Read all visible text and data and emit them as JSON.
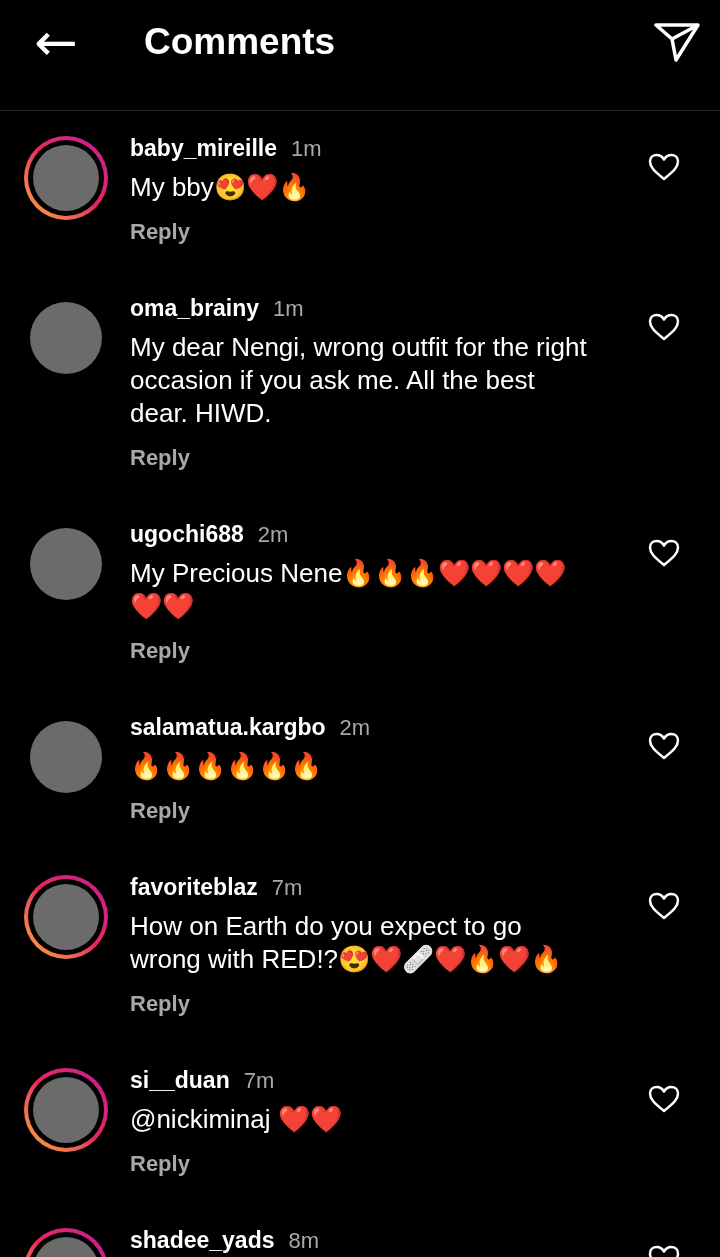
{
  "header": {
    "back_icon": "←",
    "title": "Comments"
  },
  "comments": [
    {
      "username": "baby_mireille",
      "time": "1m",
      "text": "My bby😍❤️🔥",
      "reply": "Reply",
      "story_ring": true
    },
    {
      "username": "oma_brainy",
      "time": "1m",
      "text": "My dear Nengi, wrong outfit for the right occasion if you ask me. All the best dear. HIWD.",
      "reply": "Reply",
      "story_ring": false
    },
    {
      "username": "ugochi688",
      "time": "2m",
      "text": "My Precious Nene🔥🔥🔥❤️❤️❤️❤️❤️❤️",
      "reply": "Reply",
      "story_ring": false
    },
    {
      "username": "salamatua.kargbo",
      "time": "2m",
      "text": "🔥🔥🔥🔥🔥🔥",
      "reply": "Reply",
      "story_ring": false
    },
    {
      "username": "favoriteblaz",
      "time": "7m",
      "text": "How on Earth do you expect to go wrong with RED!?😍❤️🩹❤️🔥❤️🔥",
      "reply": "Reply",
      "story_ring": true
    },
    {
      "username": "si__duan",
      "time": "7m",
      "text": "@nickiminaj ❤️❤️",
      "reply": "Reply",
      "story_ring": true
    },
    {
      "username": "shadee_yads",
      "time": "8m",
      "story_ring": true
    }
  ]
}
